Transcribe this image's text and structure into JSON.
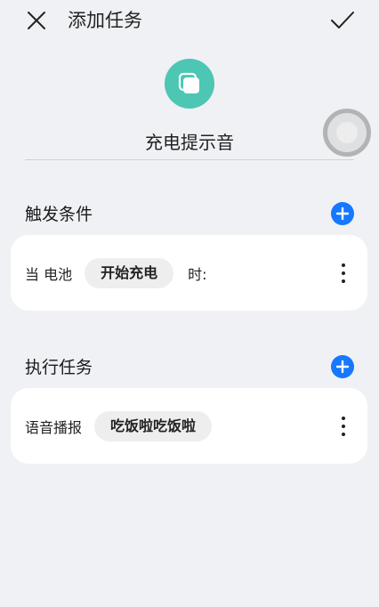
{
  "header": {
    "title": "添加任务",
    "close_icon": "close-icon",
    "confirm_icon": "check-icon"
  },
  "task": {
    "icon": "copy-icon",
    "icon_color": "#4dc6b4",
    "name": "充电提示音"
  },
  "trigger": {
    "section_title": "触发条件",
    "row": {
      "label": "当 电池",
      "chip": "开始充电",
      "after": "时:"
    }
  },
  "action": {
    "section_title": "执行任务",
    "row": {
      "label": "语音播报",
      "chip": "吃饭啦吃饭啦"
    }
  },
  "colors": {
    "accent": "#1677ff",
    "background": "#f0f1f5",
    "card": "#ffffff"
  }
}
